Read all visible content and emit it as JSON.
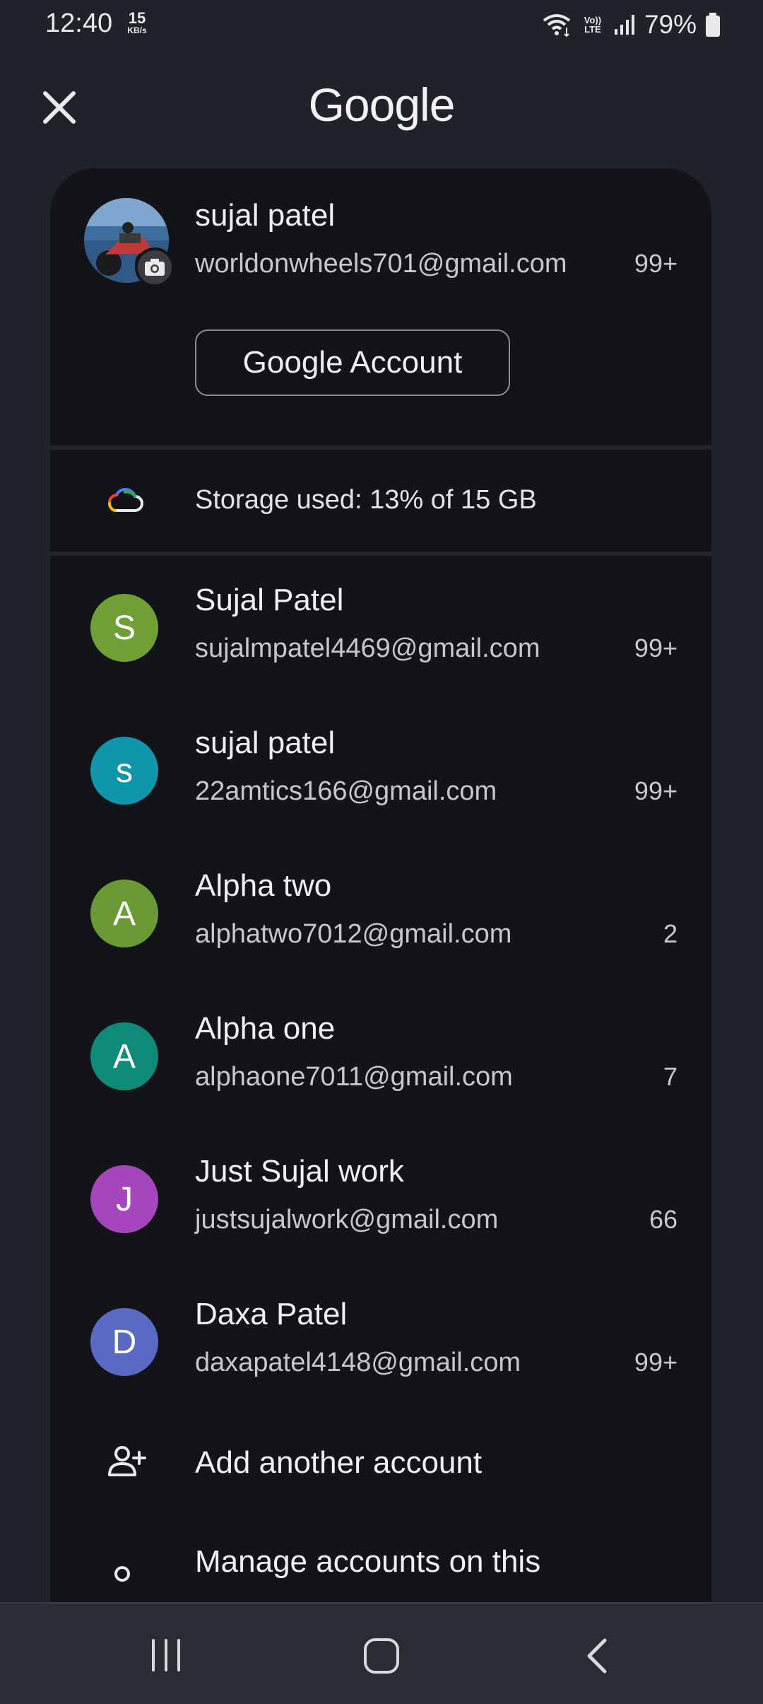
{
  "status_bar": {
    "time": "12:40",
    "net_speed_value": "15",
    "net_speed_unit": "KB/s",
    "volte": "Vo)) LTE",
    "battery": "79%"
  },
  "header": {
    "title": "Google",
    "close_icon": "close-icon"
  },
  "current_account": {
    "name": "sujal patel",
    "email": "worldonwheels701@gmail.com",
    "unread": "99+",
    "manage_button": "Google Account"
  },
  "storage": {
    "text": "Storage used: 13% of 15 GB",
    "icon": "cloud-icon"
  },
  "accounts": [
    {
      "initial": "S",
      "name": "Sujal Patel",
      "email": "sujalmpatel4469@gmail.com",
      "unread": "99+",
      "color": "#6f9f35"
    },
    {
      "initial": "s",
      "name": "sujal patel",
      "email": "22amtics166@gmail.com",
      "unread": "99+",
      "color": "#0f96aa"
    },
    {
      "initial": "A",
      "name": "Alpha two",
      "email": "alphatwo7012@gmail.com",
      "unread": "2",
      "color": "#6a9a34"
    },
    {
      "initial": "A",
      "name": "Alpha one",
      "email": "alphaone7011@gmail.com",
      "unread": "7",
      "color": "#0d8a78"
    },
    {
      "initial": "J",
      "name": "Just Sujal work",
      "email": "justsujalwork@gmail.com",
      "unread": "66",
      "color": "#a646bd"
    },
    {
      "initial": "D",
      "name": "Daxa Patel",
      "email": "daxapatel4148@gmail.com",
      "unread": "99+",
      "color": "#5a6ac2"
    }
  ],
  "actions": {
    "add_account": "Add another account",
    "manage_accounts": "Manage accounts on this"
  },
  "nav": {
    "recents_icon": "recents-icon",
    "home_icon": "home-icon",
    "back_icon": "back-icon"
  }
}
